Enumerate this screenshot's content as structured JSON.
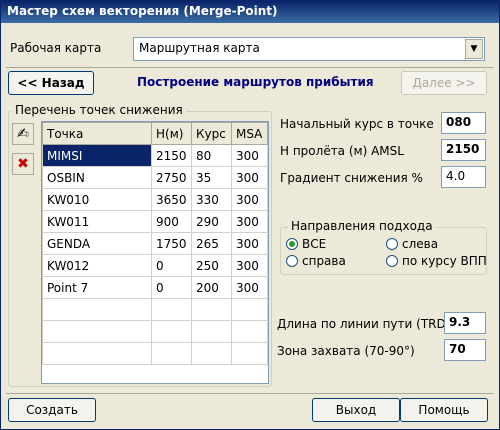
{
  "window": {
    "title": "Мастер схем векторения (Merge-Point)"
  },
  "map": {
    "label": "Рабочая карта",
    "selected": "Маршрутная карта"
  },
  "nav": {
    "back": "<< Назад",
    "title": "Построение маршрутов прибытия",
    "next": "Далее >>"
  },
  "points": {
    "group_title": "Перечень точек снижения",
    "columns": [
      "Точка",
      "Н(м)",
      "Курс",
      "MSA"
    ],
    "rows": [
      [
        "MIMSI",
        "2150",
        "80",
        "300"
      ],
      [
        "OSBIN",
        "2750",
        "35",
        "300"
      ],
      [
        "KW010",
        "3650",
        "330",
        "300"
      ],
      [
        "KW011",
        "900",
        "290",
        "300"
      ],
      [
        "GENDA",
        "1750",
        "265",
        "300"
      ],
      [
        "KW012",
        "0",
        "250",
        "300"
      ],
      [
        "Point 7",
        "0",
        "200",
        "300"
      ]
    ]
  },
  "params": {
    "initial_course_label": "Начальный курс в точке",
    "initial_course_value": "080",
    "height_label": "Н пролёта (м) AMSL",
    "height_value": "2150",
    "gradient_label": "Градиент снижения %",
    "gradient_value": "4.0"
  },
  "approach": {
    "group_title": "Направления подхода",
    "options": [
      "ВСЕ",
      "слева",
      "справа",
      "по курсу ВПП"
    ],
    "selected": "ВСЕ"
  },
  "path": {
    "trd_label": "Длина по линии пути (TRD)",
    "trd_value": "9.3",
    "capture_label": "Зона захвата (70-90°)",
    "capture_value": "70"
  },
  "footer": {
    "create": "Создать",
    "exit": "Выход",
    "help": "Помощь"
  },
  "colors": {
    "title_bar": "#0a246a",
    "selection": "#0a246a",
    "heading": "#000080"
  }
}
